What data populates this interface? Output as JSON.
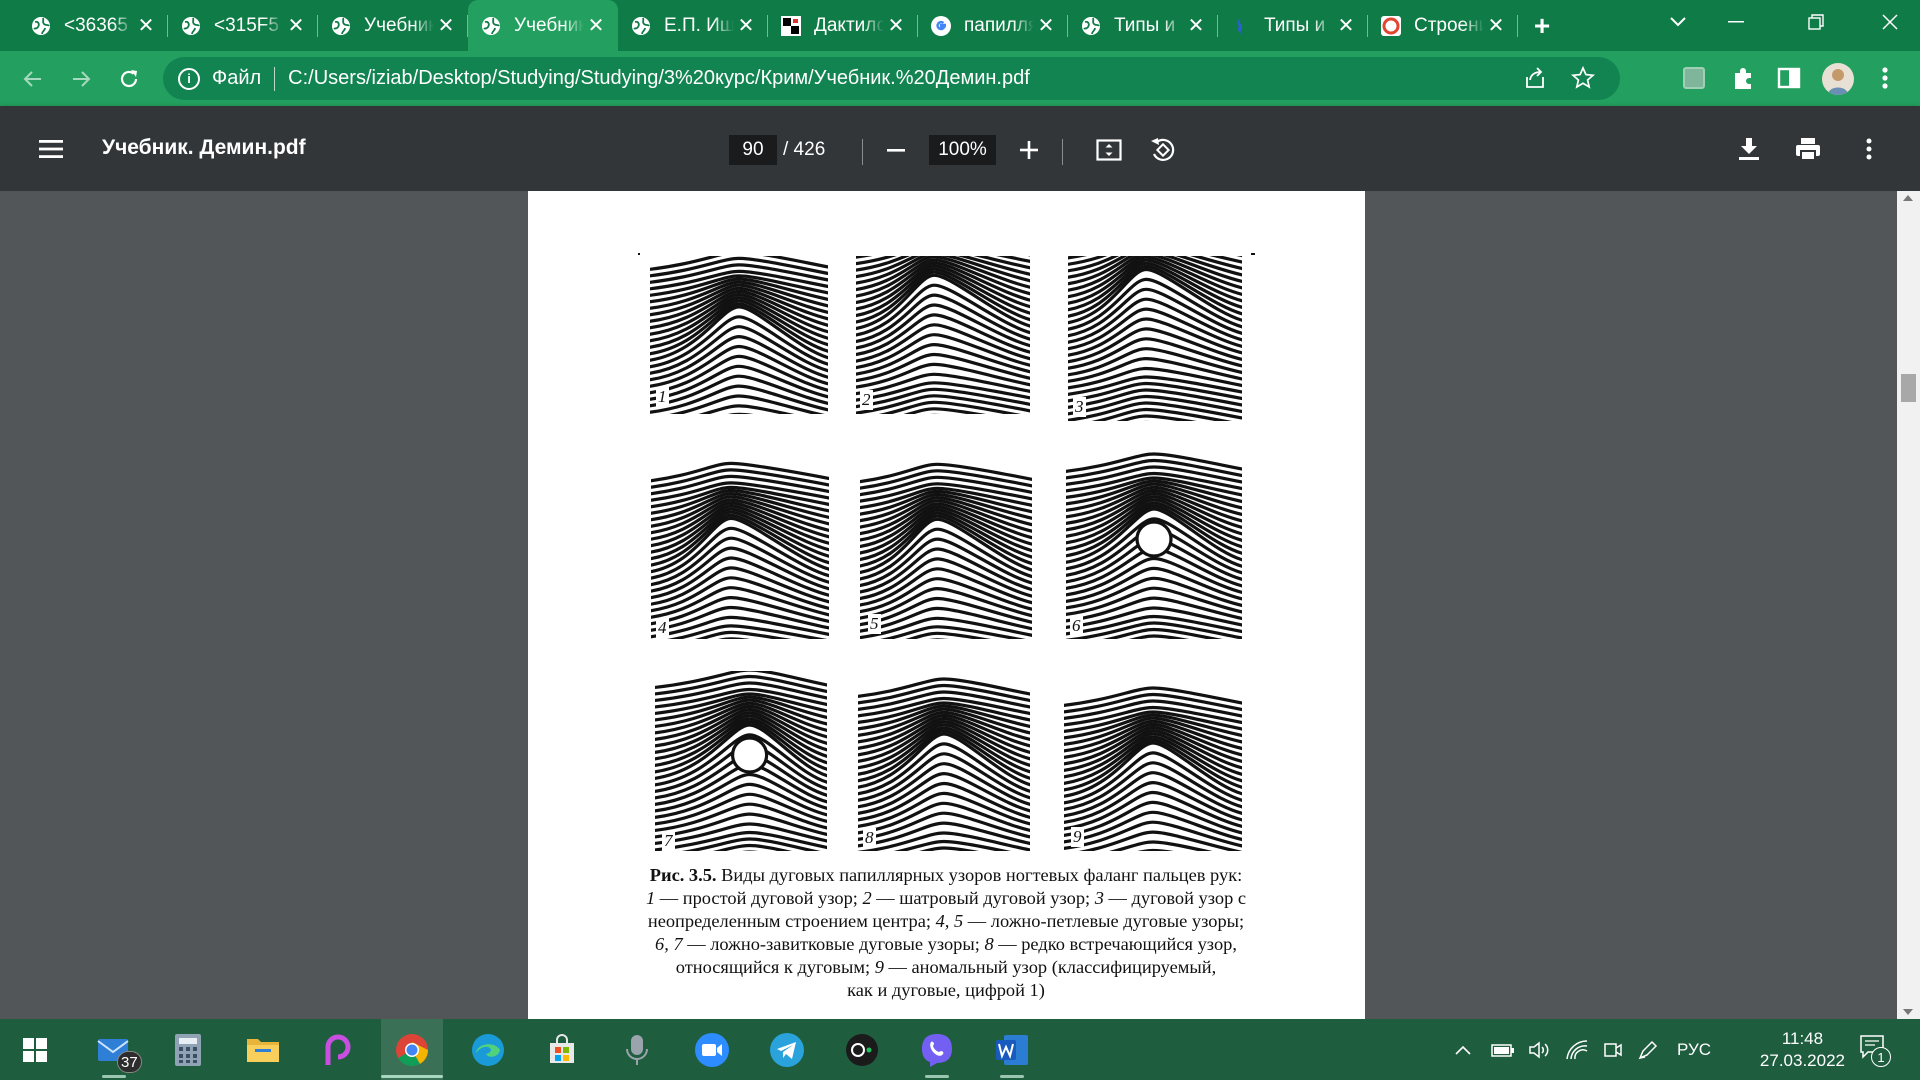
{
  "tabs": [
    {
      "title": "<36365",
      "icon": "globe-icon",
      "active": false
    },
    {
      "title": "<315F5",
      "icon": "globe-icon",
      "active": false
    },
    {
      "title": "Учебник",
      "icon": "globe-icon",
      "active": false
    },
    {
      "title": "Учебник",
      "icon": "globe-icon",
      "active": true
    },
    {
      "title": "Е.П. Ищенко",
      "icon": "globe-icon",
      "active": false
    },
    {
      "title": "Дактилоскопия",
      "icon": "dactyl-favicon",
      "active": false
    },
    {
      "title": "папиллярные",
      "icon": "google-icon",
      "active": false
    },
    {
      "title": "Типы и",
      "icon": "globe-icon",
      "active": false
    },
    {
      "title": "Типы и",
      "icon": "seahorse-favicon",
      "active": false
    },
    {
      "title": "Строение",
      "icon": "lifebuoy-favicon",
      "active": false
    }
  ],
  "address": {
    "scheme_label": "Файл",
    "url": "C:/Users/iziab/Desktop/Studying/Studying/3%20курс/Крим/Учебник.%20Демин.pdf"
  },
  "pdf": {
    "title": "Учебник. Демин.pdf",
    "current_page": "90",
    "total_pages": "/ 426",
    "zoom": "100%"
  },
  "figure": {
    "labels": [
      "1",
      "2",
      "3",
      "4",
      "5",
      "6",
      "7",
      "8",
      "9"
    ],
    "caption": {
      "prefix": "Рис. 3.5.",
      "l1": " Виды дуговых папиллярных узоров ногтевых фаланг пальцев рук:",
      "n1": "1",
      "t1": " — простой дуговой узор; ",
      "n2": "2",
      "t2": " — шатровый дуговой узор; ",
      "n3": "3",
      "t3": " — дуговой узор с",
      "l3": "неопределенным строением центра; ",
      "n45": "4, 5",
      "t45": " — ложно-петлевые дуговые узоры;",
      "n67": "6, 7",
      "t67": " — ложно-завитковые дуговые узоры; ",
      "n8": "8",
      "t8": " — редко встречающийся узор,",
      "l5": "относящийся к дуговым; ",
      "n9": "9",
      "t9": " — аномальный узор (классифицируемый,",
      "l6": "как и дуговые, цифрой 1)"
    }
  },
  "taskbar": {
    "apps": [
      "start-button",
      "mail-app",
      "calculator-app",
      "file-explorer-app",
      "picsart-app",
      "chrome-app",
      "edge-app",
      "store-app",
      "recorder-app",
      "zoom-app",
      "telegram-app",
      "obs-app",
      "viber-app",
      "word-app"
    ],
    "mail_badge": "37",
    "language": "РУС",
    "time": "11:48",
    "date": "27.03.2022",
    "notifications": "1"
  },
  "colors": {
    "tabstrip": "#0f7b47",
    "toolbar": "#23a05f",
    "pdf_toolbar": "#323639",
    "viewer_bg": "#525659",
    "taskbar": "#1f5d3f"
  }
}
